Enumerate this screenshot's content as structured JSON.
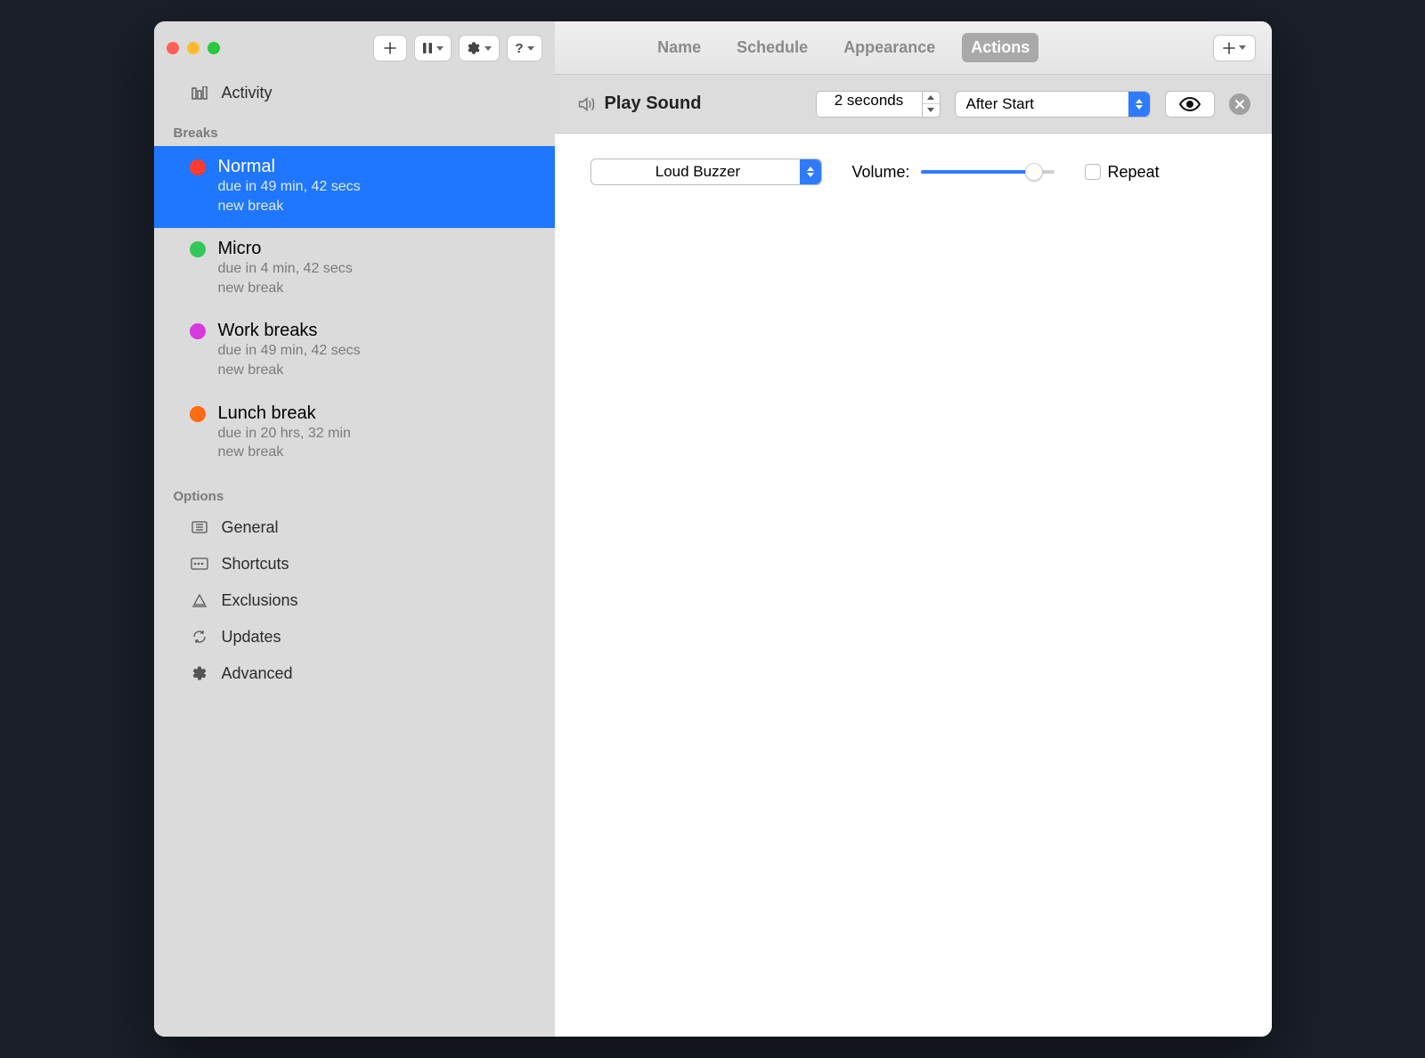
{
  "sidebar": {
    "activity_label": "Activity",
    "breaks_header": "Breaks",
    "options_header": "Options",
    "breaks": [
      {
        "name": "Normal",
        "due": "due in 49 min, 42 secs",
        "note": "new break",
        "color": "#ff3b30",
        "selected": true
      },
      {
        "name": "Micro",
        "due": "due in 4 min, 42 secs",
        "note": "new break",
        "color": "#34c759",
        "selected": false
      },
      {
        "name": "Work breaks",
        "due": "due in 49 min, 42 secs",
        "note": "new break",
        "color": "#d63adf",
        "selected": false
      },
      {
        "name": "Lunch break",
        "due": "due in 20 hrs, 32 min",
        "note": "new break",
        "color": "#ff6a13",
        "selected": false
      }
    ],
    "options": [
      {
        "key": "general",
        "label": "General"
      },
      {
        "key": "shortcuts",
        "label": "Shortcuts"
      },
      {
        "key": "exclusions",
        "label": "Exclusions"
      },
      {
        "key": "updates",
        "label": "Updates"
      },
      {
        "key": "advanced",
        "label": "Advanced"
      }
    ]
  },
  "tabs": {
    "name": "Name",
    "schedule": "Schedule",
    "appearance": "Appearance",
    "actions": "Actions",
    "active": "actions"
  },
  "action": {
    "title": "Play Sound",
    "delay_value": "2 seconds",
    "timing_value": "After Start",
    "sound_value": "Loud Buzzer",
    "volume_label": "Volume:",
    "volume_pct": 85,
    "repeat_label": "Repeat",
    "repeat_checked": false
  }
}
